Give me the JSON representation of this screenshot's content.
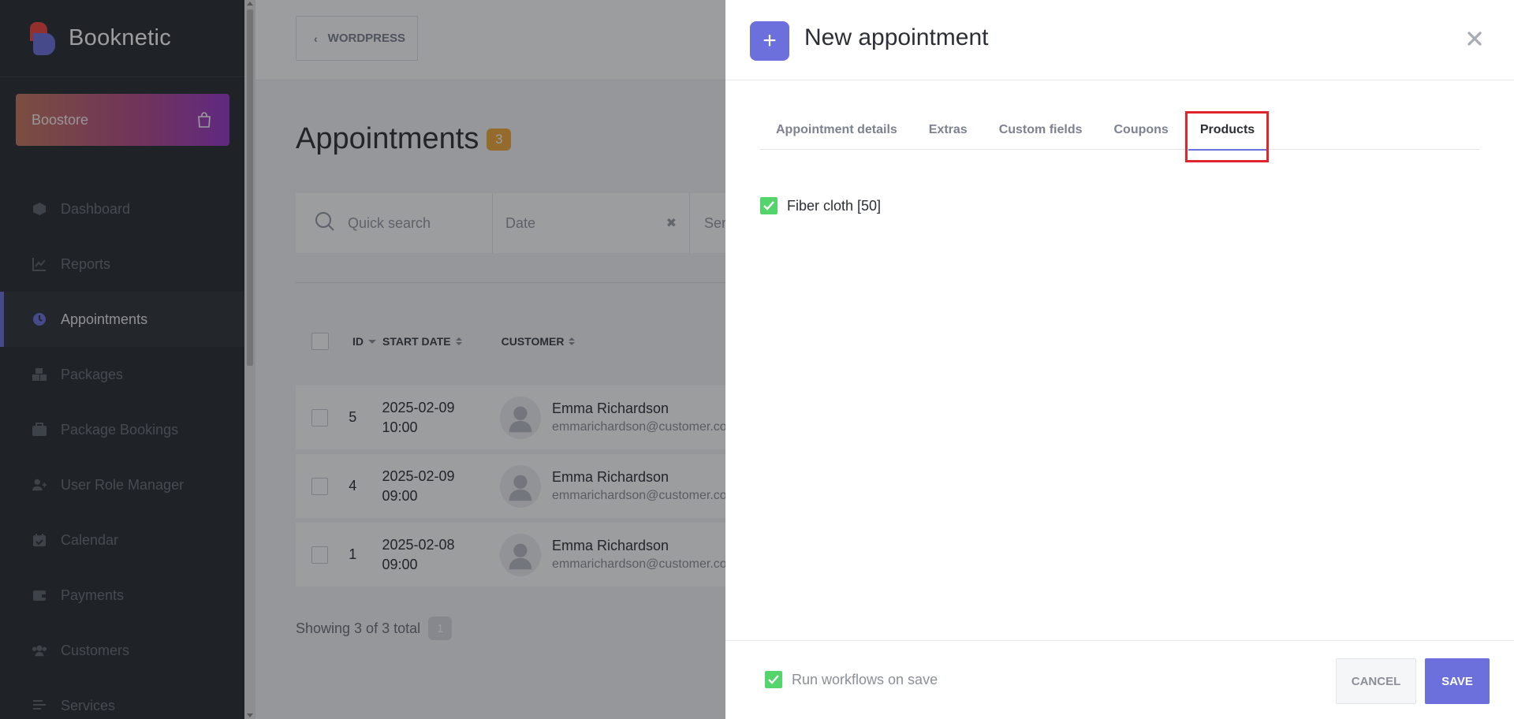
{
  "app": {
    "name": "Booknetic"
  },
  "sidebar": {
    "boostore_label": "Boostore",
    "items": [
      {
        "label": "Dashboard",
        "icon": "dashboard-icon"
      },
      {
        "label": "Reports",
        "icon": "reports-icon"
      },
      {
        "label": "Appointments",
        "icon": "clock-icon",
        "active": true
      },
      {
        "label": "Packages",
        "icon": "packages-icon"
      },
      {
        "label": "Package Bookings",
        "icon": "package-bookings-icon"
      },
      {
        "label": "User Role Manager",
        "icon": "user-role-icon"
      },
      {
        "label": "Calendar",
        "icon": "calendar-icon"
      },
      {
        "label": "Payments",
        "icon": "wallet-icon"
      },
      {
        "label": "Customers",
        "icon": "customers-icon"
      },
      {
        "label": "Services",
        "icon": "services-icon"
      }
    ]
  },
  "topbar": {
    "back_label": "WORDPRESS"
  },
  "page": {
    "title": "Appointments",
    "count": "3",
    "search_placeholder": "Quick search",
    "date_placeholder": "Date",
    "service_placeholder": "Ser",
    "showing_text": "Showing 3 of 3 total",
    "current_page": "1"
  },
  "table": {
    "headers": {
      "id": "ID",
      "start_date": "START DATE",
      "customer": "CUSTOMER"
    },
    "rows": [
      {
        "id": "5",
        "date": "2025-02-09",
        "time": "10:00",
        "name": "Emma Richardson",
        "email": "emmarichardson@customer.com"
      },
      {
        "id": "4",
        "date": "2025-02-09",
        "time": "09:00",
        "name": "Emma Richardson",
        "email": "emmarichardson@customer.com"
      },
      {
        "id": "1",
        "date": "2025-02-08",
        "time": "09:00",
        "name": "Emma Richardson",
        "email": "emmarichardson@customer.com"
      }
    ]
  },
  "modal": {
    "title": "New appointment",
    "tabs": [
      {
        "label": "Appointment details"
      },
      {
        "label": "Extras"
      },
      {
        "label": "Custom fields"
      },
      {
        "label": "Coupons"
      },
      {
        "label": "Products",
        "active": true
      }
    ],
    "product": {
      "label": "Fiber cloth [50]",
      "checked": true
    },
    "footer": {
      "workflows_label": "Run workflows on save",
      "workflows_checked": true,
      "cancel_label": "CANCEL",
      "save_label": "SAVE"
    }
  },
  "colors": {
    "accent": "#6c70dc",
    "sidebar_bg": "#292d32",
    "badge_orange": "#f2a93b",
    "checkbox_green": "#53d56c",
    "highlight_red": "#e0252c"
  }
}
